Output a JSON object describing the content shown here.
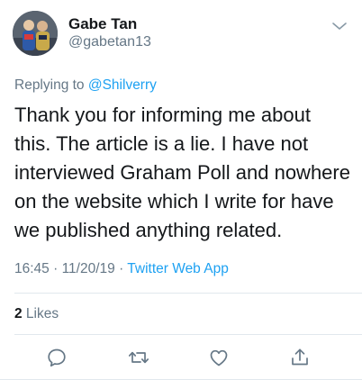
{
  "author": {
    "name": "Gabe Tan",
    "handle": "@gabetan13"
  },
  "reply": {
    "prefix": "Replying to ",
    "mention": "@Shilverry"
  },
  "tweet": {
    "text": "Thank you for informing me about this. The article is a lie. I have not interviewed Graham Poll and nowhere on the website which I write for have we published anything related."
  },
  "meta": {
    "time": "16:45",
    "sep1": " · ",
    "date": "11/20/19",
    "sep2": " · ",
    "app": "Twitter Web App"
  },
  "stats": {
    "likes_count": "2",
    "likes_label": " Likes"
  },
  "icons": {
    "caret": "chevron-down-icon",
    "reply": "comment-icon",
    "retweet": "retweet-icon",
    "like": "heart-icon",
    "share": "share-icon"
  },
  "colors": {
    "accent": "#1da1f2",
    "secondary": "#657786",
    "text": "#14171a",
    "divider": "#e1e8ed"
  }
}
